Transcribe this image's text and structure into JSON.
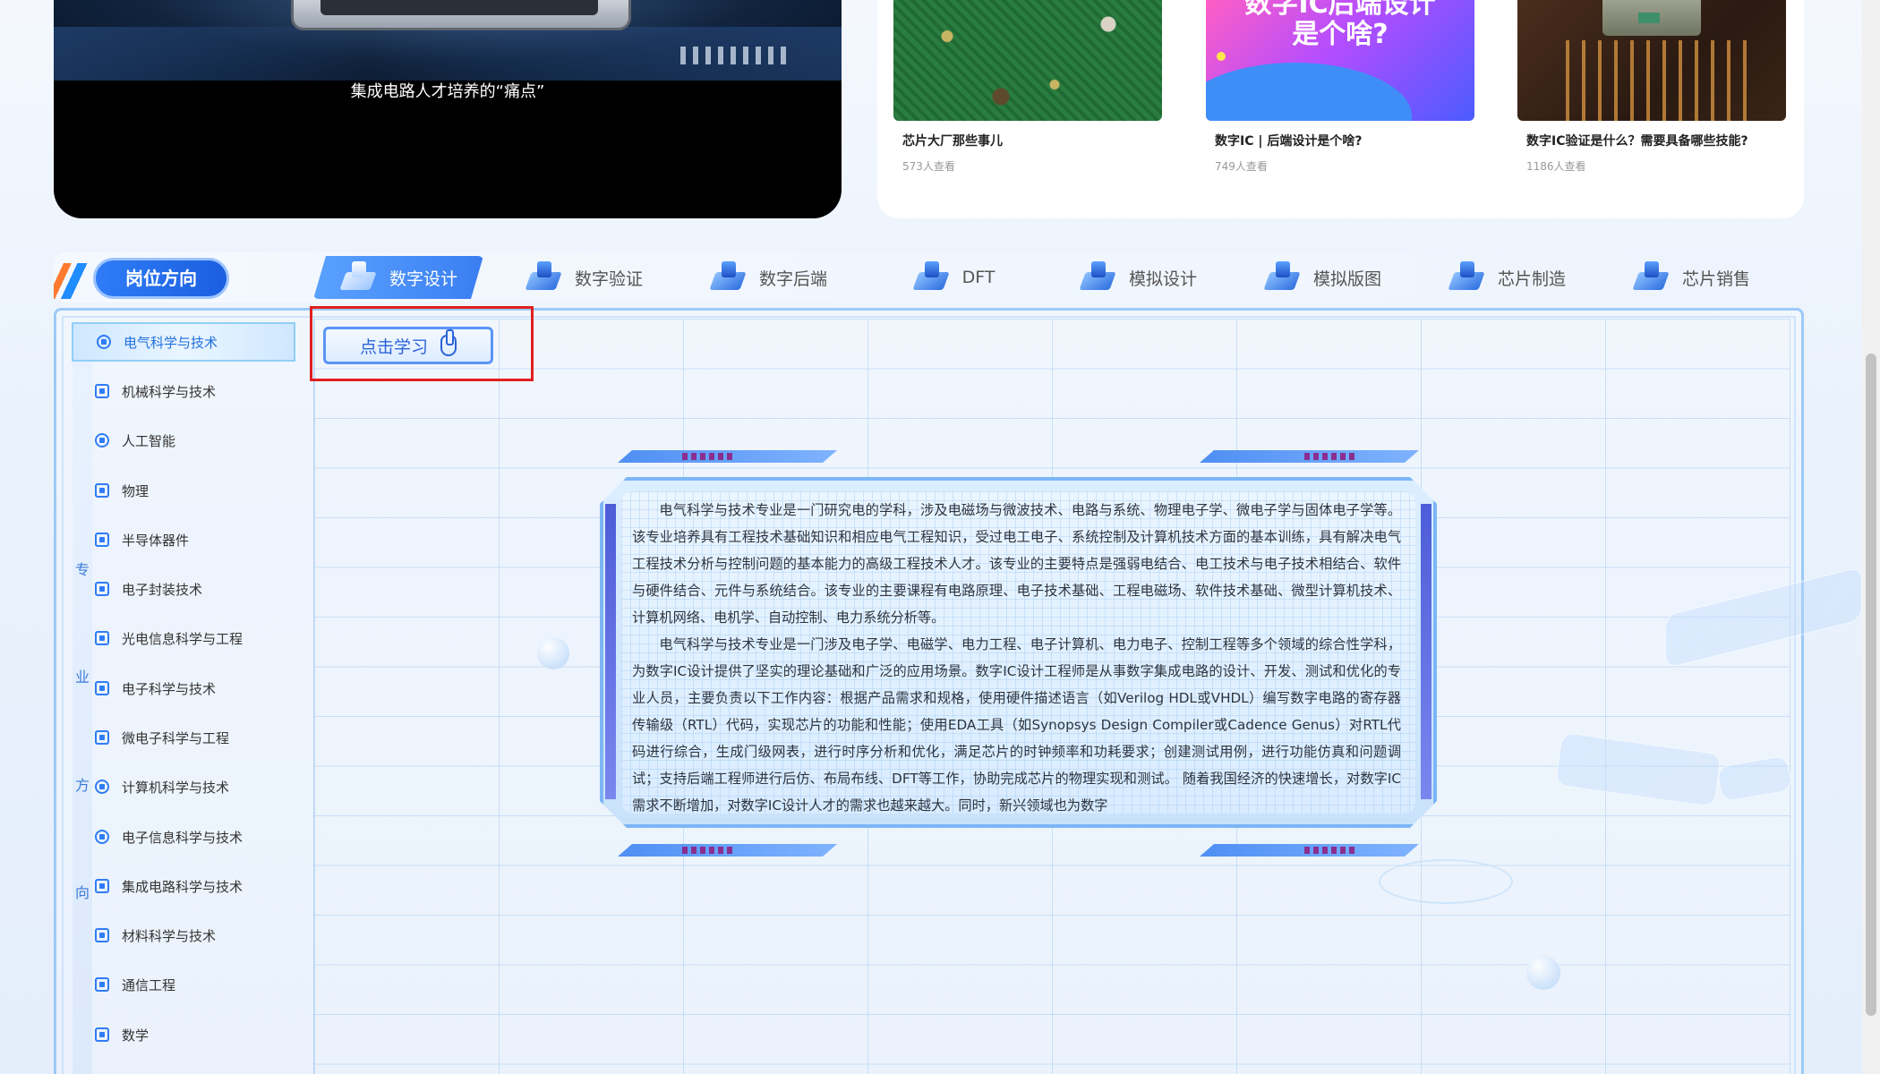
{
  "video": {
    "caption": "集成电路人才培养的“痛点”"
  },
  "articles": [
    {
      "title": "芯片大厂那些事儿",
      "views": "573人查看"
    },
    {
      "title": "数字IC | 后端设计是个啥?",
      "views": "749人查看",
      "thumb_text_1": "数字IC后端设计",
      "thumb_text_2": "是个啥?"
    },
    {
      "title": "数字IC验证是什么？需要具备哪些技能?",
      "views": "1186人查看"
    }
  ],
  "direction_badge": "岗位方向",
  "tabs": [
    {
      "label": "数字设计",
      "active": true
    },
    {
      "label": "数字验证",
      "active": false
    },
    {
      "label": "数字后端",
      "active": false
    },
    {
      "label": "DFT",
      "active": false
    },
    {
      "label": "模拟设计",
      "active": false
    },
    {
      "label": "模拟版图",
      "active": false
    },
    {
      "label": "芯片制造",
      "active": false
    },
    {
      "label": "芯片销售",
      "active": false
    }
  ],
  "vertical_label": [
    "专",
    "业",
    "方",
    "向"
  ],
  "majors": [
    {
      "label": "电气科学与技术",
      "active": true,
      "icon": "gear-icon"
    },
    {
      "label": "机械科学与技术",
      "active": false,
      "icon": "grid-icon"
    },
    {
      "label": "人工智能",
      "active": false,
      "icon": "ai-icon"
    },
    {
      "label": "物理",
      "active": false,
      "icon": "physics-icon"
    },
    {
      "label": "半导体器件",
      "active": false,
      "icon": "cube-icon"
    },
    {
      "label": "电子封装技术",
      "active": false,
      "icon": "package-icon"
    },
    {
      "label": "光电信息科学与工程",
      "active": false,
      "icon": "lightning-icon"
    },
    {
      "label": "电子科学与技术",
      "active": false,
      "icon": "monitor-icon"
    },
    {
      "label": "微电子科学与工程",
      "active": false,
      "icon": "chip-icon"
    },
    {
      "label": "计算机科学与技术",
      "active": false,
      "icon": "shield-icon"
    },
    {
      "label": "电子信息科学与技术",
      "active": false,
      "icon": "globe-icon"
    },
    {
      "label": "集成电路科学与技术",
      "active": false,
      "icon": "apps-icon"
    },
    {
      "label": "材料科学与技术",
      "active": false,
      "icon": "material-icon"
    },
    {
      "label": "通信工程",
      "active": false,
      "icon": "signal-icon"
    },
    {
      "label": "数学",
      "active": false,
      "icon": "calculator-icon"
    }
  ],
  "learn_button": "点击学习",
  "description": {
    "paragraph_1": "电气科学与技术专业是一门研究电的学科，涉及电磁场与微波技术、电路与系统、物理电子学、微电子学与固体电子学等。该专业培养具有工程技术基础知识和相应电气工程知识，受过电工电子、系统控制及计算机技术方面的基本训练，具有解决电气工程技术分析与控制问题的基本能力的高级工程技术人才。该专业的主要特点是强弱电结合、电工技术与电子技术相结合、软件与硬件结合、元件与系统结合。该专业的主要课程有电路原理、电子技术基础、工程电磁场、软件技术基础、微型计算机技术、计算机网络、电机学、自动控制、电力系统分析等。",
    "paragraph_2": "电气科学与技术专业是一门涉及电子学、电磁学、电力工程、电子计算机、电力电子、控制工程等多个领域的综合性学科，为数字IC设计提供了坚实的理论基础和广泛的应用场景。数字IC设计工程师是从事数字集成电路的设计、开发、测试和优化的专业人员，主要负责以下工作内容：根据产品需求和规格，使用硬件描述语言（如Verilog HDL或VHDL）编写数字电路的寄存器传输级（RTL）代码，实现芯片的功能和性能；使用EDA工具（如Synopsys Design Compiler或Cadence Genus）对RTL代码进行综合，生成门级网表，进行时序分析和优化，满足芯片的时钟频率和功耗要求；创建测试用例，进行功能仿真和问题调试；支持后端工程师进行后仿、布局布线、DFT等工作，协助完成芯片的物理实现和测试。 随着我国经济的快速增长，对数字IC需求不断增加，对数字IC设计人才的需求也越来越大。同时，新兴领域也为数字"
  }
}
